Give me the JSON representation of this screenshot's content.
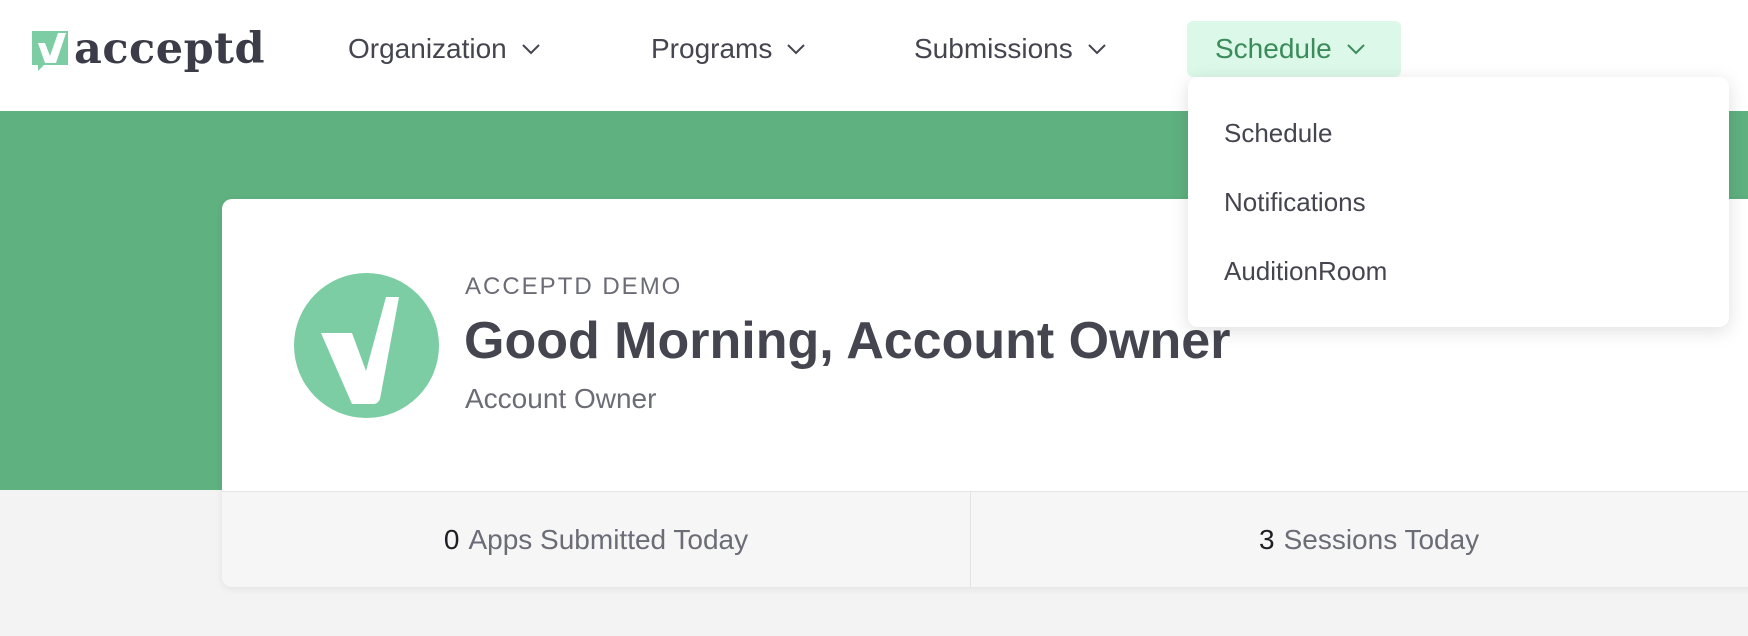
{
  "brand": {
    "logo_text": "acceptd",
    "logo_icon": "acceptd-check-icon",
    "accent_color": "#5fb180"
  },
  "nav": {
    "items": [
      {
        "label": "Organization"
      },
      {
        "label": "Programs"
      },
      {
        "label": "Submissions"
      },
      {
        "label": "Schedule",
        "active": true
      }
    ]
  },
  "dropdown": {
    "items": [
      {
        "label": "Schedule"
      },
      {
        "label": "Notifications"
      },
      {
        "label": "AuditionRoom"
      }
    ]
  },
  "profile": {
    "org_name": "ACCEPTD DEMO",
    "greeting": "Good Morning, Account Owner",
    "role": "Account Owner",
    "avatar_icon": "acceptd-avatar-icon"
  },
  "stats": [
    {
      "value": "0",
      "label": "Apps Submitted Today"
    },
    {
      "value": "3",
      "label": "Sessions Today"
    }
  ]
}
